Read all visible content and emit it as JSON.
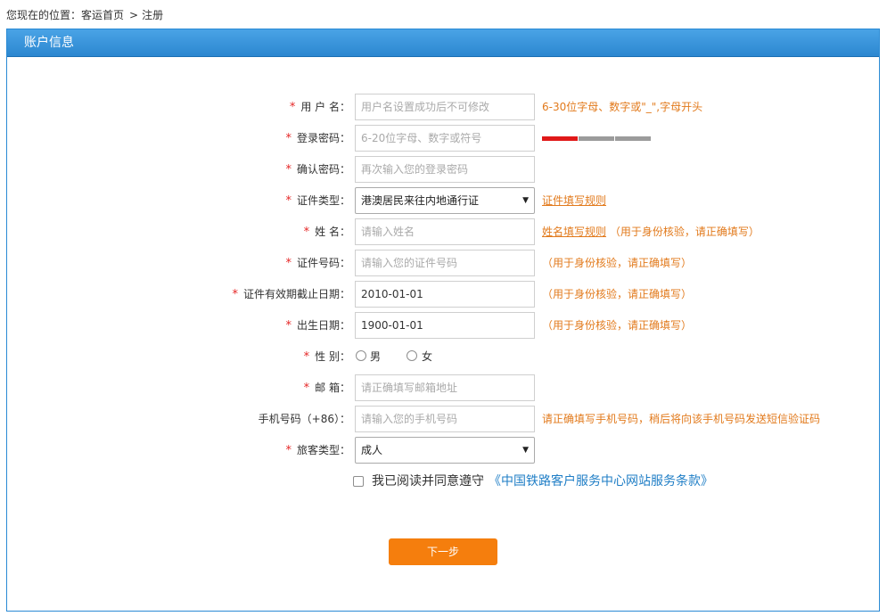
{
  "breadcrumb": {
    "prefix": "您现在的位置：",
    "home": "客运首页",
    "separator": ">",
    "current": "注册"
  },
  "panel": {
    "title": "账户信息"
  },
  "form": {
    "username": {
      "label": "用 户 名：",
      "placeholder": "用户名设置成功后不可修改",
      "hint": "6-30位字母、数字或\"_\",字母开头"
    },
    "password": {
      "label": "登录密码：",
      "placeholder": "6-20位字母、数字或符号"
    },
    "confirm": {
      "label": "确认密码：",
      "placeholder": "再次输入您的登录密码"
    },
    "idtype": {
      "label": "证件类型：",
      "value": "港澳居民来往内地通行证",
      "rule_link": "证件填写规则"
    },
    "name": {
      "label": "姓 名：",
      "placeholder": "请输入姓名",
      "rule_link": "姓名填写规则",
      "hint": "（用于身份核验，请正确填写）"
    },
    "idno": {
      "label": "证件号码：",
      "placeholder": "请输入您的证件号码",
      "hint": "（用于身份核验，请正确填写）"
    },
    "expiry": {
      "label": "证件有效期截止日期：",
      "value": "2010-01-01",
      "hint": "（用于身份核验，请正确填写）"
    },
    "birth": {
      "label": "出生日期：",
      "value": "1900-01-01",
      "hint": "（用于身份核验，请正确填写）"
    },
    "gender": {
      "label": "性 别：",
      "male": "男",
      "female": "女"
    },
    "email": {
      "label": "邮 箱：",
      "placeholder": "请正确填写邮箱地址"
    },
    "mobile": {
      "label": "手机号码（+86）：",
      "placeholder": "请输入您的手机号码",
      "hint": "请正确填写手机号码，稍后将向该手机号码发送短信验证码"
    },
    "passenger": {
      "label": "旅客类型：",
      "value": "成人"
    },
    "required_mark": "*"
  },
  "agreement": {
    "text": "我已阅读并同意遵守",
    "link": "《中国铁路客户服务中心网站服务条款》"
  },
  "next_button": "下一步",
  "colors": {
    "header": "#2c87d0",
    "hint": "#e27a1c",
    "required": "#e52727",
    "button": "#f57e0d",
    "link": "#1f7ec6"
  }
}
